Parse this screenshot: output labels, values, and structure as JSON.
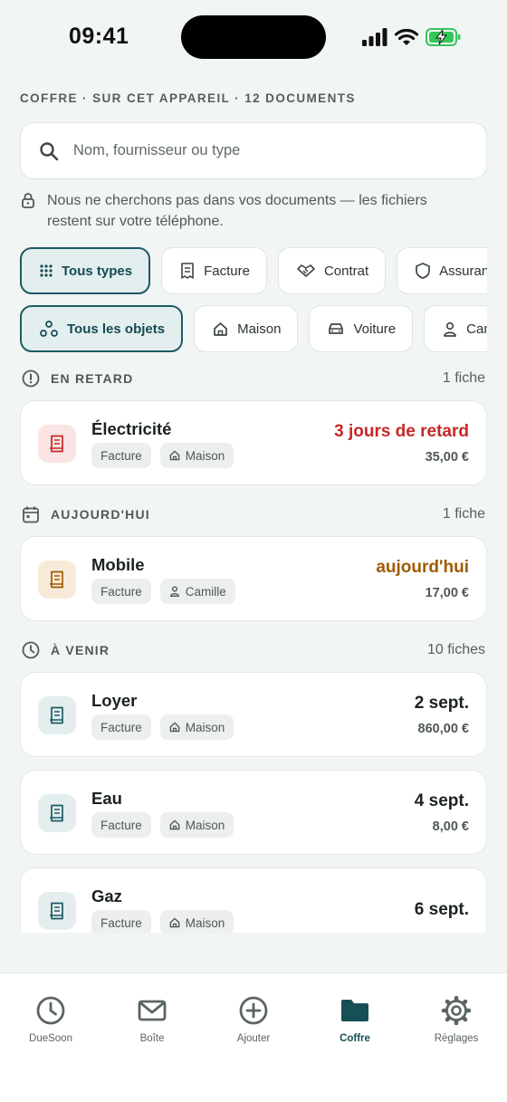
{
  "status_bar": {
    "time": "09:41"
  },
  "header": {
    "title": "COFFRE · SUR CET APPAREIL · 12 DOCUMENTS"
  },
  "search": {
    "placeholder": "Nom, fournisseur ou type"
  },
  "privacy_note": "Nous ne cherchons pas dans vos documents — les fichiers restent sur votre téléphone.",
  "type_filters": [
    {
      "label": "Tous types",
      "icon": "grid-icon",
      "active": true
    },
    {
      "label": "Facture",
      "icon": "receipt-icon",
      "active": false
    },
    {
      "label": "Contrat",
      "icon": "handshake-icon",
      "active": false
    },
    {
      "label": "Assurance",
      "icon": "shield-icon",
      "active": false
    }
  ],
  "object_filters": [
    {
      "label": "Tous les objets",
      "icon": "objects-icon",
      "active": true
    },
    {
      "label": "Maison",
      "icon": "home-icon",
      "active": false
    },
    {
      "label": "Voiture",
      "icon": "car-icon",
      "active": false
    },
    {
      "label": "Camille",
      "icon": "person-icon",
      "active": false
    }
  ],
  "sections": {
    "late": {
      "title": "EN RETARD",
      "count": "1 fiche"
    },
    "today": {
      "title": "AUJOURD'HUI",
      "count": "1 fiche"
    },
    "upcoming": {
      "title": "À VENIR",
      "count": "10 fiches"
    }
  },
  "documents": [
    {
      "name": "Électricité",
      "type": "Facture",
      "object": "Maison",
      "object_icon": "home-icon",
      "due": "3 jours de retard",
      "amount": "35,00 €",
      "status": "late"
    },
    {
      "name": "Mobile",
      "type": "Facture",
      "object": "Camille",
      "object_icon": "person-icon",
      "due": "aujourd'hui",
      "amount": "17,00 €",
      "status": "today"
    },
    {
      "name": "Loyer",
      "type": "Facture",
      "object": "Maison",
      "object_icon": "home-icon",
      "due": "2 sept.",
      "amount": "860,00 €",
      "status": "upcoming"
    },
    {
      "name": "Eau",
      "type": "Facture",
      "object": "Maison",
      "object_icon": "home-icon",
      "due": "4 sept.",
      "amount": "8,00 €",
      "status": "upcoming"
    },
    {
      "name": "Gaz",
      "type": "Facture",
      "object": "Maison",
      "object_icon": "home-icon",
      "due": "6 sept.",
      "amount": "",
      "status": "upcoming"
    }
  ],
  "tabs": [
    {
      "label": "DueSoon",
      "icon": "clock-icon",
      "active": false
    },
    {
      "label": "Boîte",
      "icon": "mail-icon",
      "active": false
    },
    {
      "label": "Ajouter",
      "icon": "plus-circle-icon",
      "active": false
    },
    {
      "label": "Coffre",
      "icon": "folder-icon",
      "active": true
    },
    {
      "label": "Réglages",
      "icon": "gear-icon",
      "active": false
    }
  ],
  "colors": {
    "accent": "#1d5a63",
    "late": "#c62828",
    "today": "#a05a00",
    "upcoming": "#1b2220",
    "late_icon_bg": "#fbe4e4",
    "today_icon_bg": "#f8ead8",
    "upcoming_icon_bg": "#e4eeee"
  }
}
